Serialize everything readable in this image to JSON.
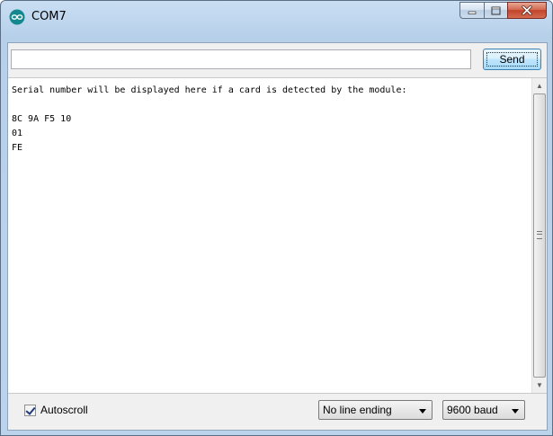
{
  "window": {
    "title": "COM7",
    "icon": "arduino-infinity-icon",
    "buttons": [
      "minimize-icon",
      "maximize-icon",
      "close-icon"
    ]
  },
  "send": {
    "input_value": "",
    "button_label": "Send"
  },
  "output": {
    "lines": [
      "Serial number will be displayed here if a card is detected by the module:",
      "",
      "8C 9A F5 10",
      "01",
      "FE"
    ]
  },
  "footer": {
    "autoscroll_label": "Autoscroll",
    "autoscroll_checked": true,
    "line_ending": "No line ending",
    "baud_rate": "9600 baud"
  },
  "colors": {
    "title_bar": "#bcd3ec",
    "close_button": "#c1432b",
    "send_button": "#bee6fd",
    "output_bg": "#ffffff"
  }
}
